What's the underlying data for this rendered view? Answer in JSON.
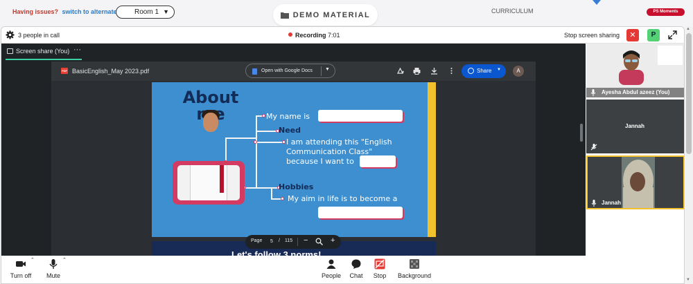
{
  "top": {
    "issues_label": "Having issues?",
    "alt_room_link": "switch to alternate room",
    "room_select": "Room 1",
    "demo_tab": "DEMO MATERIAL",
    "curriculum_tab": "CURRICULUM",
    "ps_moments": "PS Moments"
  },
  "call_header": {
    "people_count": "3 people in call",
    "recording_label": "Recording",
    "recording_time": "7:01",
    "stop_share": "Stop screen sharing",
    "x_label": "✕",
    "p_label": "P"
  },
  "stage": {
    "share_label": "Screen share (You)",
    "more": "···"
  },
  "pdf": {
    "badge": "PDF",
    "filename": "BasicEnglish_May 2023.pdf",
    "open_with": "Open with Google Docs",
    "share": "Share",
    "avatar_letter": "A",
    "page_label": "Page",
    "page_current": "5",
    "page_sep": "/",
    "page_total": "115"
  },
  "slide": {
    "title_line1": "About",
    "title_line2": "me",
    "my_name": "My name is",
    "need": "Need",
    "attending_1": "I am attending this \"English",
    "attending_2": "Communication Class\"",
    "attending_3": "because I want to",
    "hobbies": "Hobbies",
    "aim": "My aim in life is to become a",
    "next_slide_teaser": "Let's follow 3 norms!"
  },
  "participants": [
    {
      "name": "Ayesha Abdul azeez (You)"
    },
    {
      "name": "Jannah"
    },
    {
      "name": "Jannah"
    }
  ],
  "controls": {
    "turn_off": "Turn off",
    "mute": "Mute",
    "people": "People",
    "chat": "Chat",
    "stop": "Stop",
    "background": "Background"
  },
  "colors": {
    "accent_green": "#3ad29f",
    "record_red": "#e53935",
    "slide_blue": "#3d8fd0",
    "slide_yellow": "#f2c12e",
    "slide_pink": "#d43b63"
  }
}
